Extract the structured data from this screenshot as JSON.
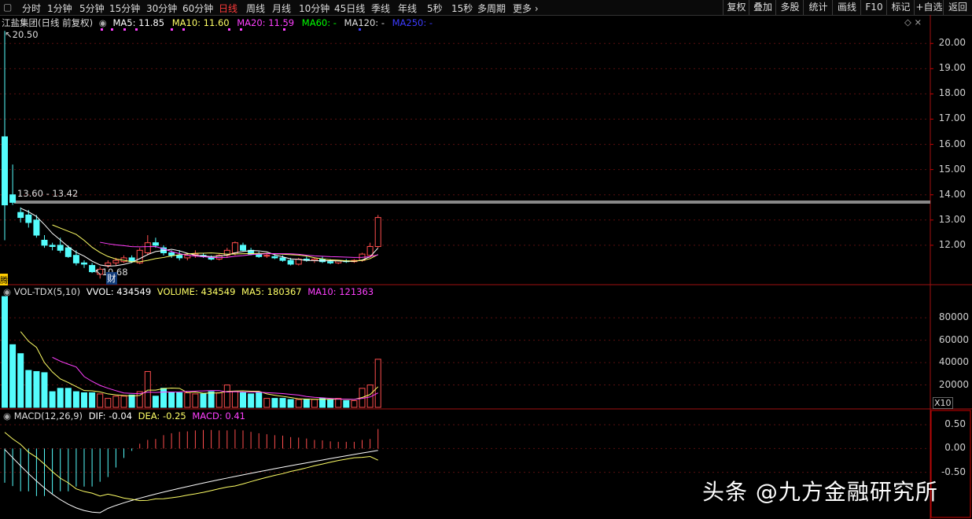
{
  "toolbar": {
    "periods": [
      "分时",
      "1分钟",
      "5分钟",
      "15分钟",
      "30分钟",
      "60分钟",
      "日线",
      "周线",
      "月线",
      "10分钟",
      "45日线",
      "季线",
      "年线",
      "5秒",
      "15秒",
      "多周期"
    ],
    "active_index": 6,
    "more": "更多",
    "right_buttons": [
      "复权",
      "叠加",
      "多股",
      "统计",
      "画线",
      "F10",
      "标记",
      "+自选",
      "返回"
    ]
  },
  "price_panel": {
    "title": "江盐集团(日线 前复权)",
    "ma5": "MA5: 11.85",
    "ma10": "MA10: 11.60",
    "ma20": "MA20: 11.59",
    "ma60": "MA60: -",
    "ma120": "MA120: -",
    "ma250": "MA250: -",
    "high_label": "20.50",
    "range_label": "13.60 - 13.42",
    "low_label": "10.68",
    "marker_cai": "财",
    "marker_left": "腾",
    "ticks": [
      "20.00",
      "19.00",
      "18.00",
      "17.00",
      "16.00",
      "15.00",
      "14.00",
      "13.00",
      "12.00"
    ]
  },
  "volume_panel": {
    "title": "VOL-TDX(5,10)",
    "vvol": "VVOL: 434549",
    "volume": "VOLUME: 434549",
    "ma5": "MA5: 180367",
    "ma10": "MA10: 121363",
    "ticks": [
      "80000",
      "60000",
      "40000",
      "20000"
    ],
    "unit": "X10"
  },
  "macd_panel": {
    "title": "MACD(12,26,9)",
    "dif": "DIF: -0.04",
    "dea": "DEA: -0.25",
    "macd": "MACD: 0.41",
    "ticks": [
      "0.50",
      "0.00",
      "-0.50"
    ]
  },
  "colors": {
    "up": "#ff4d4d",
    "down": "#54fcfc",
    "ma5": "#ffffff",
    "ma10": "#ffff66",
    "ma20": "#ff40ff",
    "ma60": "#00ff00",
    "ma250": "#3c3cff",
    "panel_border": "#a01010"
  },
  "watermark": "头条 @九方金融研究所",
  "chart_data": {
    "type": "candlestick",
    "candles": [
      {
        "o": 16.3,
        "h": 20.5,
        "l": 12.2,
        "c": 13.6
      },
      {
        "o": 14.0,
        "h": 15.2,
        "l": 13.6,
        "c": 13.7
      },
      {
        "o": 13.3,
        "h": 13.5,
        "l": 12.9,
        "c": 13.1
      },
      {
        "o": 13.2,
        "h": 13.4,
        "l": 12.7,
        "c": 12.9
      },
      {
        "o": 13.0,
        "h": 13.2,
        "l": 12.3,
        "c": 12.4
      },
      {
        "o": 12.2,
        "h": 12.4,
        "l": 11.9,
        "c": 12.0
      },
      {
        "o": 12.0,
        "h": 12.1,
        "l": 11.8,
        "c": 11.95
      },
      {
        "o": 12.0,
        "h": 12.3,
        "l": 11.7,
        "c": 11.8
      },
      {
        "o": 11.9,
        "h": 12.0,
        "l": 11.5,
        "c": 11.55
      },
      {
        "o": 11.6,
        "h": 11.8,
        "l": 11.2,
        "c": 11.3
      },
      {
        "o": 11.3,
        "h": 11.4,
        "l": 11.1,
        "c": 11.25
      },
      {
        "o": 11.2,
        "h": 11.3,
        "l": 10.9,
        "c": 10.95
      },
      {
        "o": 10.85,
        "h": 11.15,
        "l": 10.68,
        "c": 11.05
      },
      {
        "o": 11.2,
        "h": 11.4,
        "l": 11.1,
        "c": 11.3
      },
      {
        "o": 11.3,
        "h": 11.5,
        "l": 11.2,
        "c": 11.4
      },
      {
        "o": 11.35,
        "h": 11.6,
        "l": 11.3,
        "c": 11.5
      },
      {
        "o": 11.5,
        "h": 11.6,
        "l": 11.3,
        "c": 11.35
      },
      {
        "o": 11.3,
        "h": 11.9,
        "l": 11.25,
        "c": 11.8
      },
      {
        "o": 11.7,
        "h": 12.4,
        "l": 11.6,
        "c": 12.1
      },
      {
        "o": 12.1,
        "h": 12.3,
        "l": 11.9,
        "c": 12.0
      },
      {
        "o": 11.9,
        "h": 12.0,
        "l": 11.6,
        "c": 11.7
      },
      {
        "o": 11.7,
        "h": 11.8,
        "l": 11.5,
        "c": 11.6
      },
      {
        "o": 11.6,
        "h": 11.8,
        "l": 11.4,
        "c": 11.5
      },
      {
        "o": 11.5,
        "h": 11.7,
        "l": 11.4,
        "c": 11.6
      },
      {
        "o": 11.6,
        "h": 11.8,
        "l": 11.5,
        "c": 11.65
      },
      {
        "o": 11.6,
        "h": 11.7,
        "l": 11.5,
        "c": 11.55
      },
      {
        "o": 11.5,
        "h": 11.6,
        "l": 11.4,
        "c": 11.45
      },
      {
        "o": 11.45,
        "h": 11.65,
        "l": 11.4,
        "c": 11.6
      },
      {
        "o": 11.6,
        "h": 11.9,
        "l": 11.5,
        "c": 11.8
      },
      {
        "o": 11.7,
        "h": 12.15,
        "l": 11.6,
        "c": 12.1
      },
      {
        "o": 12.0,
        "h": 12.1,
        "l": 11.75,
        "c": 11.8
      },
      {
        "o": 11.8,
        "h": 11.9,
        "l": 11.6,
        "c": 11.65
      },
      {
        "o": 11.65,
        "h": 11.75,
        "l": 11.5,
        "c": 11.55
      },
      {
        "o": 11.6,
        "h": 11.7,
        "l": 11.5,
        "c": 11.6
      },
      {
        "o": 11.55,
        "h": 11.65,
        "l": 11.45,
        "c": 11.5
      },
      {
        "o": 11.5,
        "h": 11.6,
        "l": 11.35,
        "c": 11.4
      },
      {
        "o": 11.4,
        "h": 11.5,
        "l": 11.2,
        "c": 11.25
      },
      {
        "o": 11.25,
        "h": 11.5,
        "l": 11.2,
        "c": 11.45
      },
      {
        "o": 11.45,
        "h": 11.55,
        "l": 11.35,
        "c": 11.4
      },
      {
        "o": 11.4,
        "h": 11.5,
        "l": 11.3,
        "c": 11.45
      },
      {
        "o": 11.45,
        "h": 11.55,
        "l": 11.3,
        "c": 11.35
      },
      {
        "o": 11.35,
        "h": 11.45,
        "l": 11.25,
        "c": 11.3
      },
      {
        "o": 11.3,
        "h": 11.4,
        "l": 11.25,
        "c": 11.38
      },
      {
        "o": 11.38,
        "h": 11.45,
        "l": 11.3,
        "c": 11.35
      },
      {
        "o": 11.35,
        "h": 11.45,
        "l": 11.3,
        "c": 11.4
      },
      {
        "o": 11.4,
        "h": 11.7,
        "l": 11.35,
        "c": 11.65
      },
      {
        "o": 11.6,
        "h": 12.1,
        "l": 11.5,
        "c": 11.95
      },
      {
        "o": 11.95,
        "h": 13.2,
        "l": 11.9,
        "c": 13.1
      }
    ],
    "volume": [
      99000,
      56000,
      48000,
      33000,
      32000,
      31000,
      14000,
      17000,
      17000,
      14000,
      13000,
      13000,
      12000,
      8000,
      10000,
      10000,
      11000,
      14000,
      32000,
      10000,
      17000,
      13000,
      13000,
      13000,
      12000,
      12000,
      14000,
      13000,
      20000,
      14000,
      13000,
      12000,
      13000,
      8000,
      8000,
      8000,
      7000,
      7000,
      7000,
      7000,
      8000,
      7000,
      8000,
      6000,
      6000,
      17000,
      20000,
      43000
    ],
    "macd_hist": [
      -0.72,
      -0.79,
      -0.9,
      -0.9,
      -1.0,
      -1.0,
      -0.95,
      -0.9,
      -0.9,
      -0.8,
      -0.8,
      -0.8,
      -0.7,
      -0.6,
      -0.4,
      -0.2,
      -0.05,
      0.1,
      0.18,
      0.2,
      0.28,
      0.32,
      0.35,
      0.36,
      0.38,
      0.39,
      0.39,
      0.38,
      0.38,
      0.4,
      0.38,
      0.35,
      0.32,
      0.3,
      0.28,
      0.27,
      0.24,
      0.23,
      0.21,
      0.18,
      0.17,
      0.15,
      0.14,
      0.14,
      0.14,
      0.18,
      0.2,
      0.41
    ],
    "price_axis": [
      10.5,
      20.6
    ],
    "volume_axis": [
      0,
      97000
    ],
    "macd_axis": [
      -1.4,
      0.7
    ]
  }
}
